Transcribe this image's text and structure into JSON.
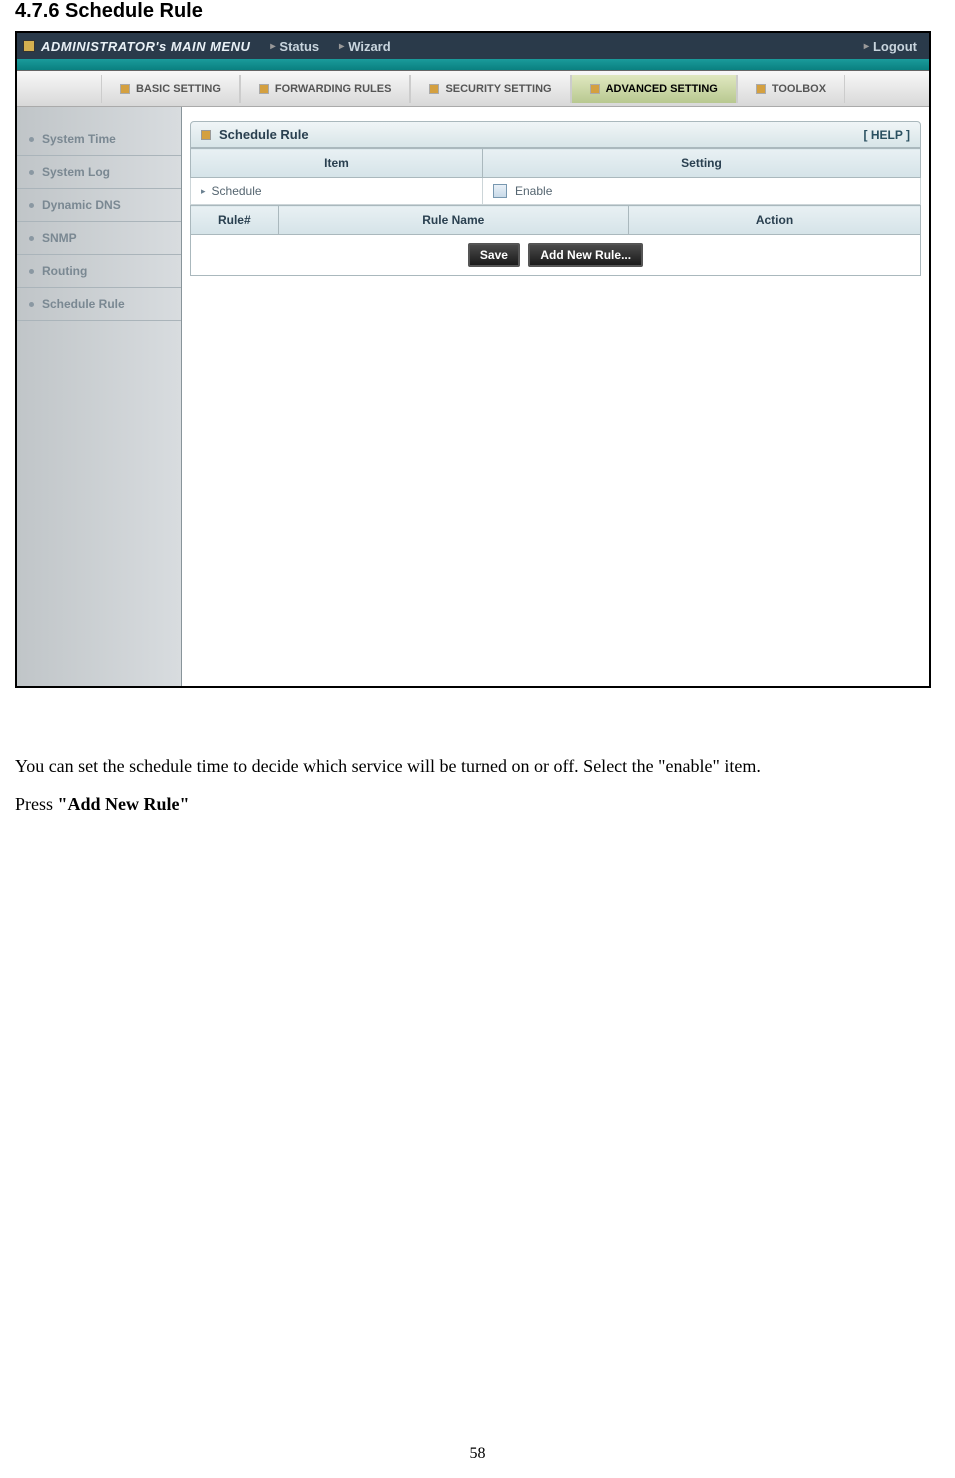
{
  "doc": {
    "heading": "4.7.6 Schedule Rule",
    "paragraph1": "You can set the schedule time to decide which service will be turned on or off. Select the \"enable\" item.",
    "paragraph2_prefix": "Press ",
    "paragraph2_bold": "\"Add New Rule\"",
    "page_num": "58"
  },
  "topbar": {
    "title": "ADMINISTRATOR's MAIN MENU",
    "status": "Status",
    "wizard": "Wizard",
    "logout": "Logout"
  },
  "tabs": {
    "basic": "BASIC SETTING",
    "forwarding": "FORWARDING RULES",
    "security": "SECURITY SETTING",
    "advanced": "ADVANCED SETTING",
    "toolbox": "TOOLBOX"
  },
  "sidebar": {
    "items": [
      {
        "label": "System Time"
      },
      {
        "label": "System Log"
      },
      {
        "label": "Dynamic DNS"
      },
      {
        "label": "SNMP"
      },
      {
        "label": "Routing"
      },
      {
        "label": "Schedule Rule"
      }
    ]
  },
  "panel": {
    "title": "Schedule Rule",
    "help": "[ HELP ]",
    "col_item": "Item",
    "col_setting": "Setting",
    "schedule_label": "Schedule",
    "enable_label": "Enable",
    "col_rule_num": "Rule#",
    "col_rule_name": "Rule Name",
    "col_action": "Action",
    "btn_save": "Save",
    "btn_add": "Add New Rule..."
  }
}
